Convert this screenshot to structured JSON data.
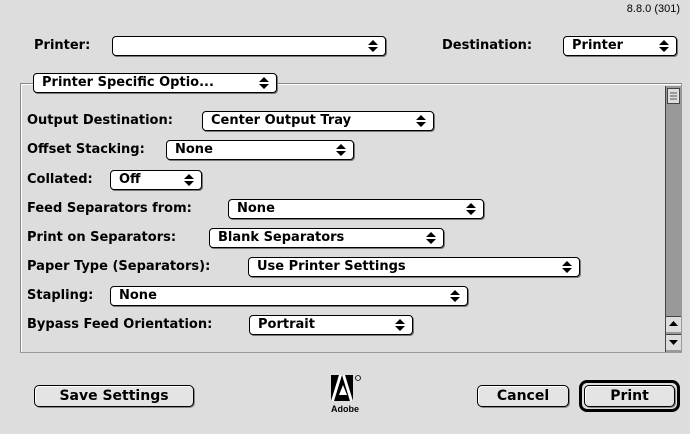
{
  "version": "8.8.0 (301)",
  "printer": {
    "label": "Printer:",
    "value": ""
  },
  "destination": {
    "label": "Destination:",
    "value": "Printer"
  },
  "panel": {
    "value": "Printer Specific Optio..."
  },
  "options": [
    {
      "label": "Output Destination:",
      "value": "Center Output Tray"
    },
    {
      "label": "Offset Stacking:",
      "value": "None"
    },
    {
      "label": "Collated:",
      "value": "Off"
    },
    {
      "label": "Feed Separators from:",
      "value": "None"
    },
    {
      "label": "Print on Separators:",
      "value": "Blank Separators"
    },
    {
      "label": "Paper Type (Separators):",
      "value": "Use Printer Settings"
    },
    {
      "label": "Stapling:",
      "value": "None"
    },
    {
      "label": "Bypass Feed Orientation:",
      "value": "Portrait"
    }
  ],
  "buttons": {
    "save": "Save Settings",
    "cancel": "Cancel",
    "print": "Print"
  },
  "logo": {
    "text": "Adobe",
    "icon": "adobe-logo-icon"
  }
}
